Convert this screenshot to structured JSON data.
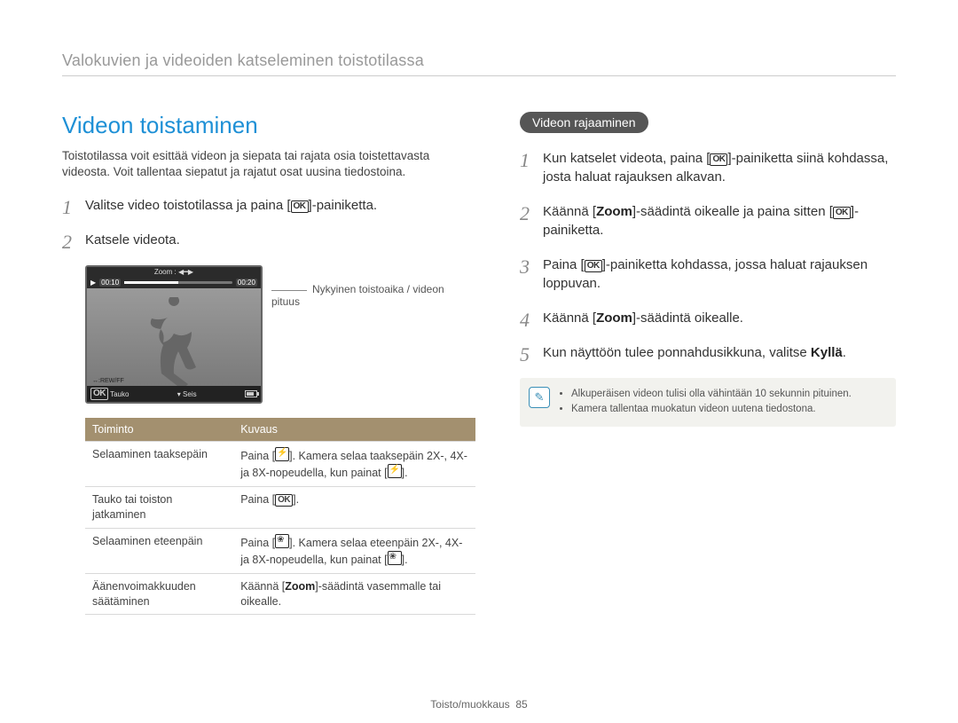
{
  "header": "Valokuvien ja videoiden katseleminen toistotilassa",
  "footer": {
    "section": "Toisto/muokkaus",
    "page": "85"
  },
  "left": {
    "title": "Videon toistaminen",
    "intro": "Toistotilassa voit esittää videon ja siepata tai rajata osia toistettavasta videosta. Voit tallentaa siepatut ja rajatut osat uusina tiedostoina.",
    "steps": [
      {
        "n": "1",
        "pre": "Valitse video toistotilassa ja paina [",
        "post": "]-painiketta."
      },
      {
        "n": "2",
        "text": "Katsele videota."
      }
    ],
    "video": {
      "zoom_label": "Zoom",
      "t_current": "00:10",
      "t_total": "00:20",
      "rewff": "↔:REW/FF",
      "bottom_left_pre": "Tauko",
      "bottom_right_pre": "Seis"
    },
    "callout": "Nykyinen toistoaika / videon pituus",
    "table": {
      "headers": [
        "Toiminto",
        "Kuvaus"
      ],
      "rows": [
        {
          "c1": "Selaaminen taaksepäin",
          "c2_pre": "Paina [",
          "c2_mid": "]. Kamera selaa taaksepäin 2X-, 4X- ja 8X-nopeudella, kun painat [",
          "c2_post": "].",
          "icon": "flash"
        },
        {
          "c1": "Tauko tai toiston jatkaminen",
          "c2_pre": "Paina [",
          "c2_post": "].",
          "icon": "ok"
        },
        {
          "c1": "Selaaminen eteenpäin",
          "c2_pre": "Paina [",
          "c2_mid": "]. Kamera selaa eteenpäin 2X-, 4X- ja 8X-nopeudella, kun painat [",
          "c2_post": "].",
          "icon": "macro"
        },
        {
          "c1": "Äänenvoimakkuuden säätäminen",
          "c2_pre": "Käännä [",
          "c2_bold": "Zoom",
          "c2_post": "]-säädintä vasemmalle tai oikealle."
        }
      ]
    }
  },
  "right": {
    "pill": "Videon rajaaminen",
    "steps": [
      {
        "n": "1",
        "pre": "Kun katselet videota, paina [",
        "post": "]-painiketta siinä kohdassa, josta haluat rajauksen alkavan."
      },
      {
        "n": "2",
        "pre": "Käännä [",
        "bold": "Zoom",
        "mid": "]-säädintä oikealle ja paina sitten [",
        "post": "]-painiketta."
      },
      {
        "n": "3",
        "pre": "Paina [",
        "post": "]-painiketta kohdassa, jossa haluat rajauksen loppuvan."
      },
      {
        "n": "4",
        "pre": "Käännä [",
        "bold": "Zoom",
        "post": "]-säädintä oikealle."
      },
      {
        "n": "5",
        "text_pre": "Kun näyttöön tulee ponnahdusikkuna, valitse ",
        "text_bold": "Kyllä",
        "text_post": "."
      }
    ],
    "notes": [
      "Alkuperäisen videon tulisi olla vähintään 10 sekunnin pituinen.",
      "Kamera tallentaa muokatun videon uutena tiedostona."
    ]
  }
}
